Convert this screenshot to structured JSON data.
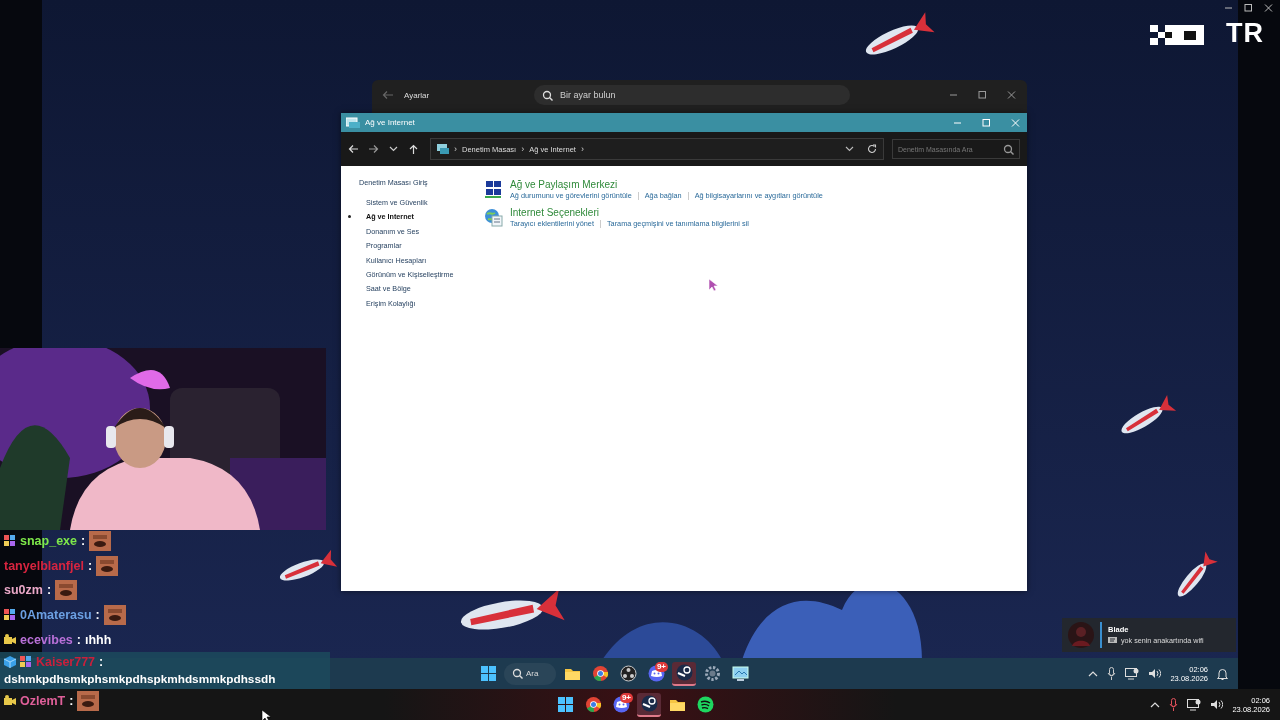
{
  "overlay": {
    "logo_text": "TR"
  },
  "settings_window": {
    "title": "Ayarlar",
    "search": {
      "placeholder": "Bir ayar bulun"
    }
  },
  "control_panel": {
    "title": "Ağ ve Internet",
    "breadcrumb": [
      {
        "separator": "›",
        "label": "Denetim Masası"
      },
      {
        "separator": "›",
        "label": "Ağ ve Internet"
      }
    ],
    "breadcrumb_end": "›",
    "search": {
      "placeholder": "Denetim Masasında Ara"
    },
    "sidebar": {
      "items": [
        {
          "label": "Denetim Masası Giriş",
          "kind": "home",
          "selected": false
        },
        {
          "label": "Sistem ve Güvenlik",
          "kind": "category",
          "selected": false
        },
        {
          "label": "Ağ ve Internet",
          "kind": "category",
          "selected": true
        },
        {
          "label": "Donanım ve Ses",
          "kind": "category",
          "selected": false
        },
        {
          "label": "Programlar",
          "kind": "category",
          "selected": false
        },
        {
          "label": "Kullanıcı Hesapları",
          "kind": "category",
          "selected": false
        },
        {
          "label": "Görünüm ve Kişiselleştirme",
          "kind": "category",
          "selected": false
        },
        {
          "label": "Saat ve Bölge",
          "kind": "category",
          "selected": false
        },
        {
          "label": "Erişim Kolaylığı",
          "kind": "category",
          "selected": false
        }
      ]
    },
    "categories": [
      {
        "kind": "network",
        "title": "Ağ ve Paylaşım Merkezi",
        "links": [
          "Ağ durumunu ve görevlerini görüntüle",
          "Ağa bağlan",
          "Ağ bilgisayarlarını ve aygıtları görüntüle"
        ]
      },
      {
        "kind": "internet",
        "title": "Internet Seçenekleri",
        "links": [
          "Tarayıcı eklentilerini yönet",
          "Tarama geçmişini ve tanımlama bilgilerini sil"
        ]
      }
    ]
  },
  "chat": {
    "messages": [
      {
        "user": "snap_exe",
        "color": "#7ee84a",
        "badges": [
          {
            "kind": "sub"
          }
        ],
        "separator": ":",
        "emote": true,
        "highlighted": false
      },
      {
        "user": "tanyelblanfjel",
        "color": "#d8243f",
        "separator": ":",
        "emote": true,
        "highlighted": false
      },
      {
        "user": "su0zm",
        "color": "#eaa8c8",
        "separator": ":",
        "emote": true,
        "highlighted": false
      },
      {
        "user": "0Amaterasu",
        "color": "#6b9fe2",
        "badges": [
          {
            "kind": "sub"
          }
        ],
        "separator": ":",
        "emote": true,
        "highlighted": false
      },
      {
        "user": "ecevibes",
        "color": "#b870d8",
        "badges": [
          {
            "kind": "video"
          }
        ],
        "separator": ":",
        "text": "ıhhh",
        "emote": false,
        "highlighted": false
      },
      {
        "user": "Kaiser777",
        "color": "#c8203c",
        "badges": [
          {
            "kind": "cube"
          },
          {
            "kind": "sub"
          }
        ],
        "separator": ":",
        "text": "dshmkpdhsmkphsmkpdhspkmhdsmmkpdhssdh",
        "emote": false,
        "highlighted": true
      },
      {
        "user": "OzlemT",
        "color": "#e0609a",
        "badges": [
          {
            "kind": "video"
          }
        ],
        "separator": ":",
        "emote": true,
        "highlighted": false
      }
    ]
  },
  "notification": {
    "sender": "Blade",
    "message": "yok senin anakartında wifi"
  },
  "inner_taskbar": {
    "search": {
      "placeholder": "Ara"
    },
    "apps": [
      {
        "kind": "explorer",
        "active": false
      },
      {
        "kind": "browser",
        "active": false
      },
      {
        "kind": "recorder",
        "active": false
      },
      {
        "kind": "chat",
        "active": false,
        "badge": "9+"
      },
      {
        "kind": "game",
        "active": true
      },
      {
        "kind": "settings",
        "active": false
      },
      {
        "kind": "remote",
        "active": false
      }
    ],
    "time": "02:06",
    "date": "23.08.2026",
    "mic_muted": false
  },
  "outer_taskbar": {
    "apps": [
      {
        "kind": "browser",
        "active": false
      },
      {
        "kind": "chat",
        "active": false,
        "badge": "9+"
      },
      {
        "kind": "game",
        "active": true
      },
      {
        "kind": "explorer",
        "active": false
      },
      {
        "kind": "music",
        "active": false
      }
    ],
    "time": "02:06",
    "date": "23.08.2026",
    "mic_muted": true
  }
}
